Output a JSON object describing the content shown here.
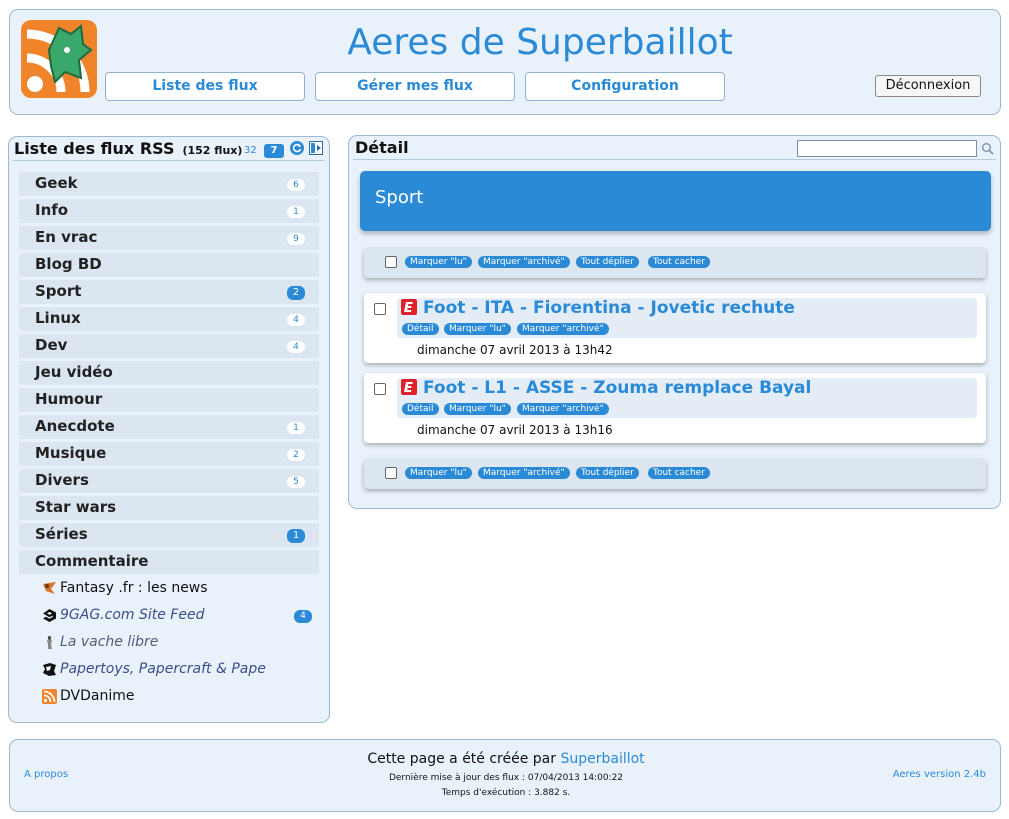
{
  "header": {
    "title": "Aeres de Superbaillot",
    "nav": [
      "Liste des flux",
      "Gérer mes flux",
      "Configuration"
    ],
    "logout": "Déconnexion"
  },
  "sidebar": {
    "title": "Liste des flux RSS",
    "count": "(152 flux)",
    "unread_total": "32",
    "unread_current": "7",
    "categories": [
      {
        "label": "Geek",
        "badge": "6"
      },
      {
        "label": "Info",
        "badge": "1"
      },
      {
        "label": "En vrac",
        "badge": "9"
      },
      {
        "label": "Blog BD",
        "badge": ""
      },
      {
        "label": "Sport",
        "badge": "2",
        "active": true
      },
      {
        "label": "Linux",
        "badge": "4"
      },
      {
        "label": "Dev",
        "badge": "4"
      },
      {
        "label": "Jeu vidéo",
        "badge": ""
      },
      {
        "label": "Humour",
        "badge": ""
      },
      {
        "label": "Anecdote",
        "badge": "1"
      },
      {
        "label": "Musique",
        "badge": "2"
      },
      {
        "label": "Divers",
        "badge": "5"
      },
      {
        "label": "Star wars",
        "badge": ""
      },
      {
        "label": "Séries",
        "badge": "1",
        "active": true
      },
      {
        "label": "Commentaire",
        "badge": ""
      }
    ],
    "feeds": [
      {
        "label": "Fantasy .fr : les news",
        "badge": ""
      },
      {
        "label": "9GAG.com Site Feed",
        "badge": "4"
      },
      {
        "label": "La vache libre",
        "badge": ""
      },
      {
        "label": "Papertoys, Papercraft & Pape",
        "badge": ""
      },
      {
        "label": "DVDanime",
        "badge": ""
      }
    ]
  },
  "detail": {
    "title": "Détail",
    "search_value": "",
    "section": "Sport",
    "actions": {
      "mark_read": "Marquer \"lu\"",
      "mark_archived": "Marquer \"archivé\"",
      "expand_all": "Tout déplier",
      "hide_all": "Tout cacher"
    },
    "article_actions": {
      "detail": "Détail",
      "mark_read": "Marquer \"lu\"",
      "mark_archived": "Marquer \"archivé\""
    },
    "articles": [
      {
        "title": "Foot - ITA - Fiorentina - Jovetic rechute",
        "date": "dimanche 07 avril 2013 à 13h42",
        "source_icon": "lequipe-icon"
      },
      {
        "title": "Foot - L1 - ASSE - Zouma remplace Bayal",
        "date": "dimanche 07 avril 2013 à 13h16",
        "source_icon": "lequipe-icon"
      }
    ]
  },
  "footer": {
    "apropos": "A propos",
    "created_prefix": "Cette page a été créée par ",
    "created_link": "Superbaillot",
    "last_update": "Dernière mise à jour des flux : 07/04/2013 14:00:22",
    "exec_time": "Temps d'exécution : 3.882 s.",
    "version": "Aeres version 2.4b"
  },
  "colors": {
    "accent": "#2a8ad6",
    "panel_bg": "#e9f2fb",
    "panel_border": "#9db8d4",
    "row_bg": "#dbe6f1"
  }
}
